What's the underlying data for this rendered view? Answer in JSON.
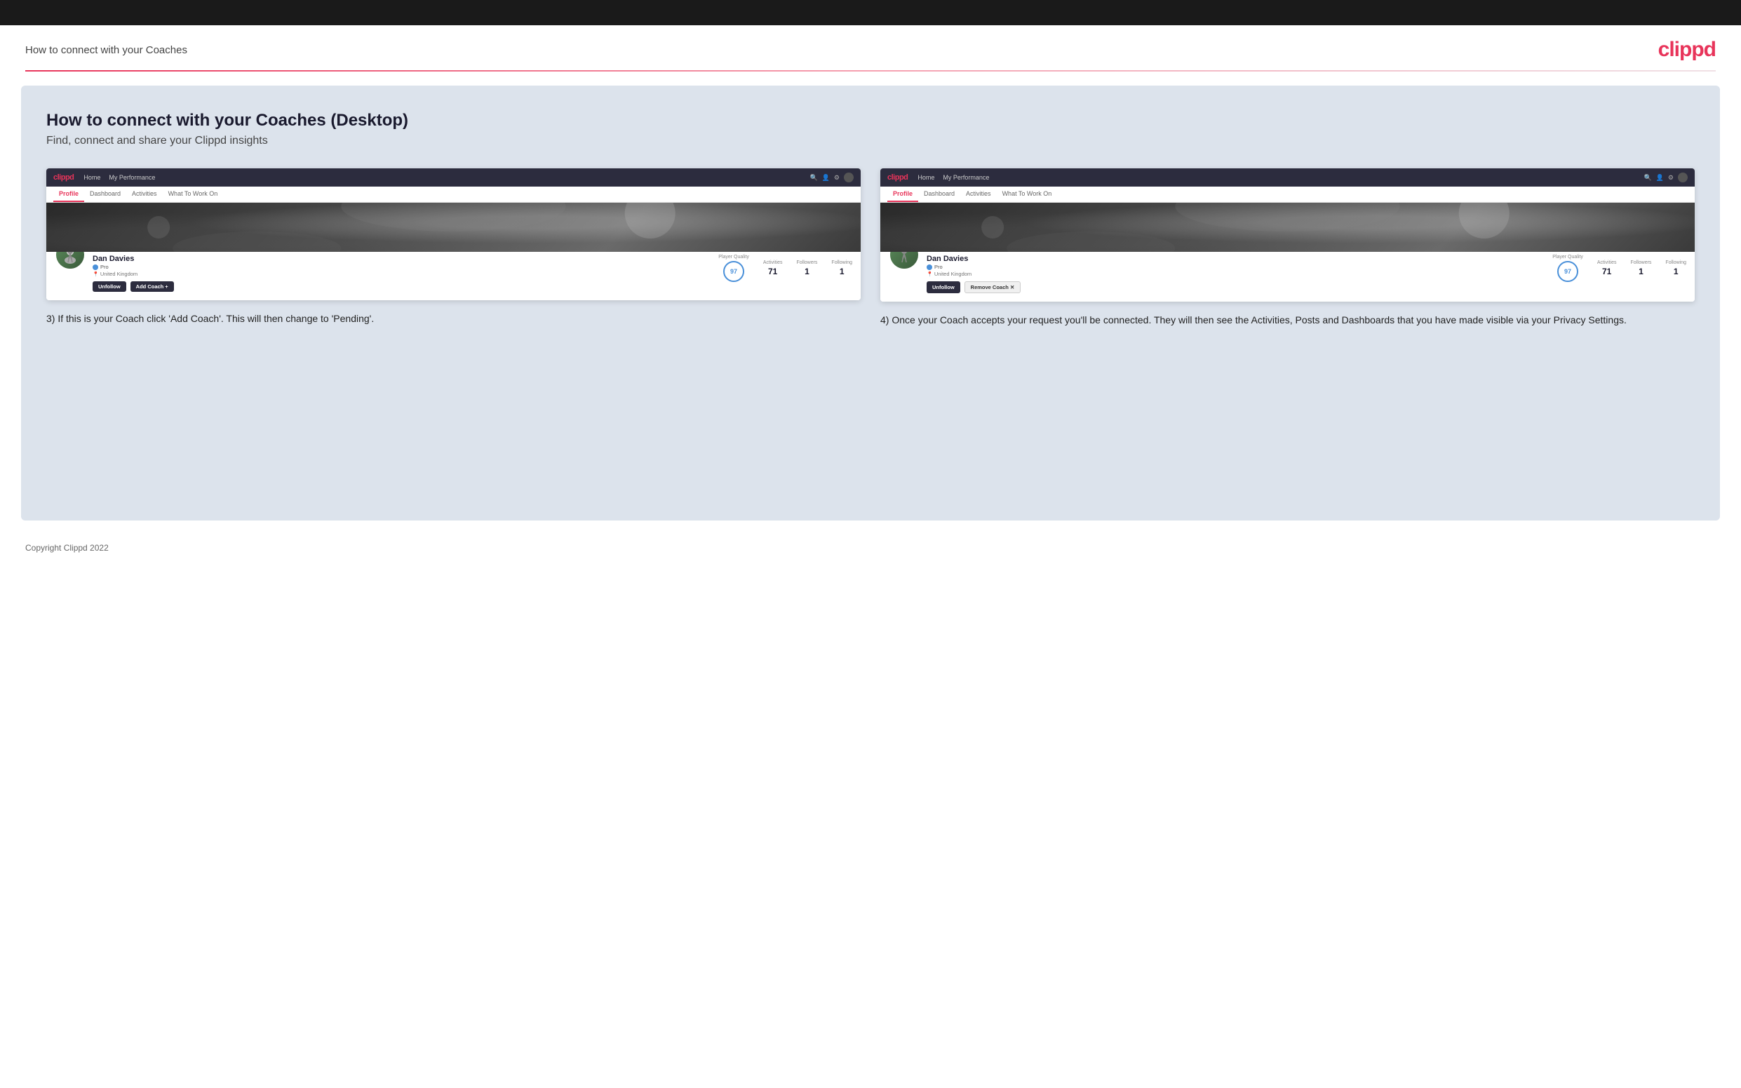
{
  "header": {
    "title": "How to connect with your Coaches",
    "logo": "clippd"
  },
  "main": {
    "title": "How to connect with your Coaches (Desktop)",
    "subtitle": "Find, connect and share your Clippd insights",
    "screenshots": [
      {
        "id": "screenshot-left",
        "nav": {
          "logo": "clippd",
          "links": [
            "Home",
            "My Performance"
          ],
          "icons": [
            "search",
            "person",
            "settings",
            "globe"
          ]
        },
        "tabs": [
          "Profile",
          "Dashboard",
          "Activities",
          "What To Work On"
        ],
        "active_tab": "Profile",
        "player": {
          "name": "Dan Davies",
          "badge": "Pro",
          "location": "United Kingdom",
          "player_quality": "97",
          "activities": "71",
          "followers": "1",
          "following": "1"
        },
        "buttons": [
          "Unfollow",
          "Add Coach"
        ]
      },
      {
        "id": "screenshot-right",
        "nav": {
          "logo": "clippd",
          "links": [
            "Home",
            "My Performance"
          ],
          "icons": [
            "search",
            "person",
            "settings",
            "globe"
          ]
        },
        "tabs": [
          "Profile",
          "Dashboard",
          "Activities",
          "What To Work On"
        ],
        "active_tab": "Profile",
        "player": {
          "name": "Dan Davies",
          "badge": "Pro",
          "location": "United Kingdom",
          "player_quality": "97",
          "activities": "71",
          "followers": "1",
          "following": "1"
        },
        "buttons": [
          "Unfollow",
          "Remove Coach"
        ]
      }
    ],
    "step3_text": "3) If this is your Coach click 'Add Coach'. This will then change to 'Pending'.",
    "step4_text": "4) Once your Coach accepts your request you'll be connected. They will then see the Activities, Posts and Dashboards that you have made visible via your Privacy Settings."
  },
  "footer": {
    "copyright": "Copyright Clippd 2022"
  },
  "labels": {
    "player_quality": "Player Quality",
    "activities": "Activities",
    "followers": "Followers",
    "following": "Following",
    "pro": "Pro",
    "united_kingdom": "United Kingdom",
    "unfollow": "Unfollow",
    "add_coach": "Add Coach",
    "remove_coach": "Remove Coach ✕",
    "home": "Home",
    "my_performance": "My Performance",
    "profile": "Profile",
    "dashboard": "Dashboard",
    "activities_tab": "Activities",
    "what_to_work_on": "What To Work On"
  }
}
